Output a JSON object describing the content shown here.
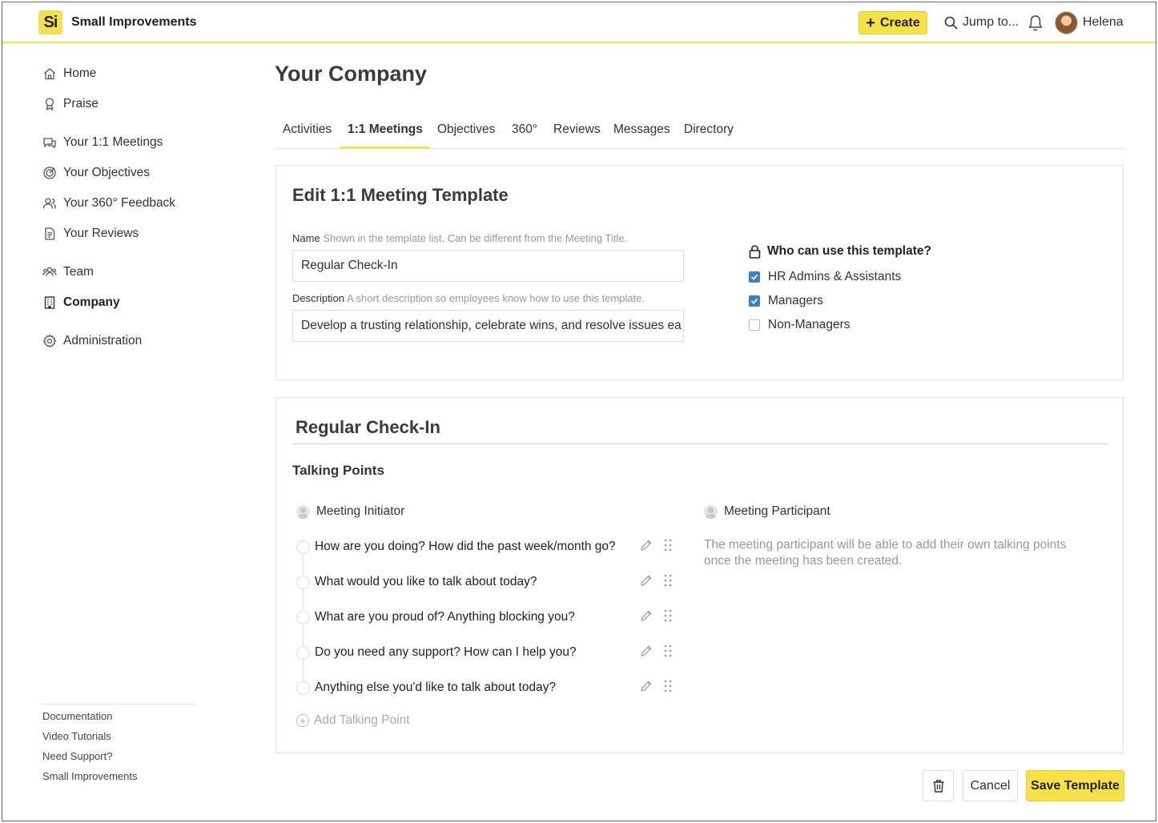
{
  "app": {
    "logo_text": "Si",
    "brand": "Small Improvements",
    "create_label": "Create",
    "jump_label": "Jump to...",
    "user_name": "Helena",
    "accent_color": "#f4e04d",
    "checkbox_color": "#3b7fd3"
  },
  "sidebar": {
    "items": [
      {
        "label": "Home",
        "icon": "home-icon"
      },
      {
        "label": "Praise",
        "icon": "award-icon"
      },
      {
        "label": "Your 1:1 Meetings",
        "icon": "chat-icon"
      },
      {
        "label": "Your Objectives",
        "icon": "target-icon"
      },
      {
        "label": "Your 360° Feedback",
        "icon": "people-icon"
      },
      {
        "label": "Your Reviews",
        "icon": "document-icon"
      },
      {
        "label": "Team",
        "icon": "team-icon"
      },
      {
        "label": "Company",
        "icon": "building-icon"
      },
      {
        "label": "Administration",
        "icon": "gear-icon"
      }
    ],
    "footer_links": [
      "Documentation",
      "Video Tutorials",
      "Need Support?",
      "Small Improvements"
    ]
  },
  "page": {
    "title": "Your Company",
    "tabs": [
      "Activities",
      "1:1 Meetings",
      "Objectives",
      "360°",
      "Reviews",
      "Messages",
      "Directory"
    ],
    "active_tab": "1:1 Meetings"
  },
  "template_form": {
    "title": "Edit 1:1 Meeting Template",
    "name_label": "Name",
    "name_hint": "Shown in the template list. Can be different from the Meeting Title.",
    "name_value": "Regular Check-In",
    "description_label": "Description",
    "description_hint": "A short description so employees know how to use this template.",
    "description_value": "Develop a trusting relationship, celebrate wins, and resolve issues ea",
    "who_title": "Who can use this template?",
    "permissions": [
      {
        "label": "HR Admins & Assistants",
        "checked": true
      },
      {
        "label": "Managers",
        "checked": true
      },
      {
        "label": "Non-Managers",
        "checked": false
      }
    ]
  },
  "preview": {
    "title": "Regular Check-In",
    "talking_points_title": "Talking Points",
    "initiator_label": "Meeting Initiator",
    "participant_label": "Meeting Participant",
    "talking_points": [
      "How are you doing? How did the past week/month go?",
      "What would you like to talk about today?",
      "What are you proud of? Anything blocking you?",
      "Do you need any support? How can I help you?",
      "Anything else you'd like to talk about today?"
    ],
    "add_talking_point": "Add Talking Point",
    "participant_note": "The meeting participant will be able to add their own talking points once the meeting has been created."
  },
  "actions": {
    "cancel": "Cancel",
    "save": "Save Template"
  }
}
